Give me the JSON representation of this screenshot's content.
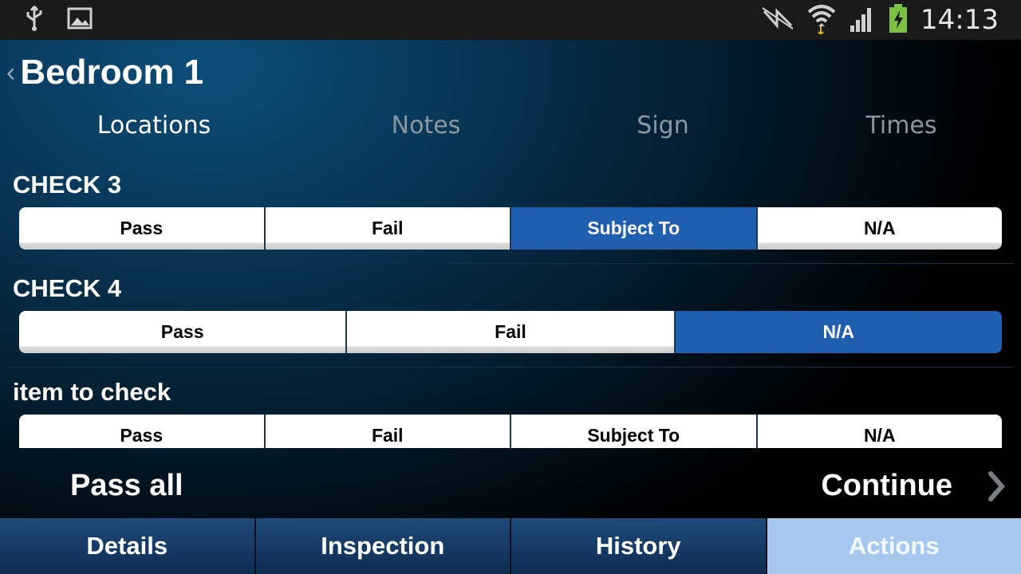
{
  "statusbar": {
    "time": "14:13",
    "icons": [
      "usb-icon",
      "gallery-icon",
      "nfc-icon",
      "wifi-icon",
      "signal-icon",
      "battery-charging-icon"
    ]
  },
  "header": {
    "title": "Bedroom 1"
  },
  "tabs": [
    {
      "label": "Locations",
      "active": true
    },
    {
      "label": "Notes",
      "active": false
    },
    {
      "label": "Sign",
      "active": false
    },
    {
      "label": "Times",
      "active": false
    }
  ],
  "checks": [
    {
      "label": "CHECK 3",
      "options": [
        "Pass",
        "Fail",
        "Subject To",
        "N/A"
      ],
      "selected": "Subject To"
    },
    {
      "label": "CHECK 4",
      "options": [
        "Pass",
        "Fail",
        "N/A"
      ],
      "selected": "N/A"
    },
    {
      "label": "item to check",
      "options": [
        "Pass",
        "Fail",
        "Subject To",
        "N/A"
      ],
      "selected": null
    }
  ],
  "actions": {
    "pass_all": "Pass all",
    "continue": "Continue"
  },
  "bottom_nav": [
    {
      "label": "Details",
      "active": false
    },
    {
      "label": "Inspection",
      "active": false
    },
    {
      "label": "History",
      "active": false
    },
    {
      "label": "Actions",
      "active": true
    }
  ],
  "colors": {
    "selected_option": "#1f5faf",
    "active_nav": "#a6c7ee",
    "nav": "#16395f"
  }
}
